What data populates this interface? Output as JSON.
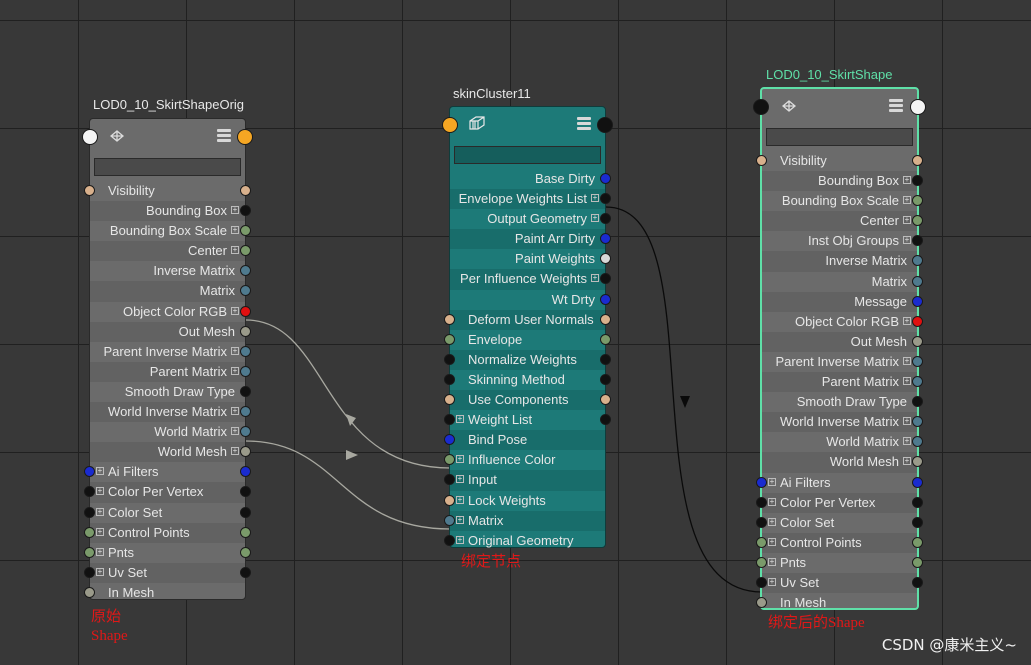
{
  "node_orig": {
    "title": "LOD0_10_SkirtShapeOrig",
    "search_value": "",
    "rows": [
      {
        "label": "Visibility",
        "side": "left",
        "exp": false,
        "lport": "#d8b08c",
        "rport": "#d8b08c"
      },
      {
        "label": "Bounding Box",
        "side": "right",
        "exp": true,
        "lport": "",
        "rport": "#111111"
      },
      {
        "label": "Bounding Box Scale",
        "side": "right",
        "exp": true,
        "lport": "",
        "rport": "#7a9a6a"
      },
      {
        "label": "Center",
        "side": "right",
        "exp": true,
        "lport": "",
        "rport": "#7a9a6a"
      },
      {
        "label": "Inverse Matrix",
        "side": "right",
        "exp": false,
        "lport": "",
        "rport": "#4f7a8e"
      },
      {
        "label": "Matrix",
        "side": "right",
        "exp": false,
        "lport": "",
        "rport": "#4f7a8e"
      },
      {
        "label": "Object Color RGB",
        "side": "right",
        "exp": true,
        "lport": "",
        "rport": "#e01010"
      },
      {
        "label": "Out Mesh",
        "side": "right",
        "exp": false,
        "lport": "",
        "rport": "#9a9a8a"
      },
      {
        "label": "Parent Inverse Matrix",
        "side": "right",
        "exp": true,
        "lport": "",
        "rport": "#4f7a8e"
      },
      {
        "label": "Parent Matrix",
        "side": "right",
        "exp": true,
        "lport": "",
        "rport": "#4f7a8e"
      },
      {
        "label": "Smooth Draw Type",
        "side": "right",
        "exp": false,
        "lport": "",
        "rport": "#111111"
      },
      {
        "label": "World Inverse Matrix",
        "side": "right",
        "exp": true,
        "lport": "",
        "rport": "#4f7a8e"
      },
      {
        "label": "World Matrix",
        "side": "right",
        "exp": true,
        "lport": "",
        "rport": "#4f7a8e"
      },
      {
        "label": "World Mesh",
        "side": "right",
        "exp": true,
        "lport": "",
        "rport": "#9a9a8a"
      },
      {
        "label": "Ai Filters",
        "side": "left",
        "exp": true,
        "lport": "#1a2bd0",
        "rport": "#1a2bd0"
      },
      {
        "label": "Color Per Vertex",
        "side": "left",
        "exp": true,
        "lport": "#111111",
        "rport": "#111111"
      },
      {
        "label": "Color Set",
        "side": "left",
        "exp": true,
        "lport": "#111111",
        "rport": "#111111"
      },
      {
        "label": "Control Points",
        "side": "left",
        "exp": true,
        "lport": "#7a9a6a",
        "rport": "#7a9a6a"
      },
      {
        "label": "Pnts",
        "side": "left",
        "exp": true,
        "lport": "#7a9a6a",
        "rport": "#7a9a6a"
      },
      {
        "label": "Uv Set",
        "side": "left",
        "exp": true,
        "lport": "#111111",
        "rport": "#111111"
      },
      {
        "label": "In Mesh",
        "side": "left",
        "exp": false,
        "lport": "#9a9a8a",
        "rport": ""
      }
    ]
  },
  "node_skin": {
    "title": "skinCluster11",
    "search_value": "",
    "rows": [
      {
        "label": "Base Dirty",
        "side": "right",
        "exp": false,
        "lport": "",
        "rport": "#1a2bd0"
      },
      {
        "label": "Envelope Weights List",
        "side": "right",
        "exp": true,
        "lport": "",
        "rport": "#111111"
      },
      {
        "label": "Output Geometry",
        "side": "right",
        "exp": true,
        "lport": "",
        "rport": "#111111"
      },
      {
        "label": "Paint Arr Dirty",
        "side": "right",
        "exp": false,
        "lport": "",
        "rport": "#1a2bd0"
      },
      {
        "label": "Paint Weights",
        "side": "right",
        "exp": false,
        "lport": "",
        "rport": "#d8d8d8"
      },
      {
        "label": "Per Influence Weights",
        "side": "right",
        "exp": true,
        "lport": "",
        "rport": "#111111"
      },
      {
        "label": "Wt Drty",
        "side": "right",
        "exp": false,
        "lport": "",
        "rport": "#1a2bd0"
      },
      {
        "label": "Deform User Normals",
        "side": "left",
        "exp": false,
        "lport": "#d8b08c",
        "rport": "#d8b08c"
      },
      {
        "label": "Envelope",
        "side": "left",
        "exp": false,
        "lport": "#7a9a6a",
        "rport": "#7a9a6a"
      },
      {
        "label": "Normalize Weights",
        "side": "left",
        "exp": false,
        "lport": "#111111",
        "rport": "#111111"
      },
      {
        "label": "Skinning Method",
        "side": "left",
        "exp": false,
        "lport": "#111111",
        "rport": "#111111"
      },
      {
        "label": "Use Components",
        "side": "left",
        "exp": false,
        "lport": "#d8b08c",
        "rport": "#d8b08c"
      },
      {
        "label": "Weight List",
        "side": "left",
        "exp": true,
        "lport": "#111111",
        "rport": "#111111"
      },
      {
        "label": "Bind Pose",
        "side": "left",
        "exp": false,
        "lport": "#1a2bd0",
        "rport": ""
      },
      {
        "label": "Influence Color",
        "side": "left",
        "exp": true,
        "lport": "#7a9a6a",
        "rport": ""
      },
      {
        "label": "Input",
        "side": "left",
        "exp": true,
        "lport": "#111111",
        "rport": ""
      },
      {
        "label": "Lock Weights",
        "side": "left",
        "exp": true,
        "lport": "#d8b08c",
        "rport": ""
      },
      {
        "label": "Matrix",
        "side": "left",
        "exp": true,
        "lport": "#4f7a8e",
        "rport": ""
      },
      {
        "label": "Original Geometry",
        "side": "left",
        "exp": true,
        "lport": "#111111",
        "rport": ""
      }
    ]
  },
  "node_shape": {
    "title": "LOD0_10_SkirtShape",
    "search_value": "",
    "rows": [
      {
        "label": "Visibility",
        "side": "left",
        "exp": false,
        "lport": "#d8b08c",
        "rport": "#d8b08c"
      },
      {
        "label": "Bounding Box",
        "side": "right",
        "exp": true,
        "lport": "",
        "rport": "#111111"
      },
      {
        "label": "Bounding Box Scale",
        "side": "right",
        "exp": true,
        "lport": "",
        "rport": "#7a9a6a"
      },
      {
        "label": "Center",
        "side": "right",
        "exp": true,
        "lport": "",
        "rport": "#7a9a6a"
      },
      {
        "label": "Inst Obj Groups",
        "side": "right",
        "exp": true,
        "lport": "",
        "rport": "#111111"
      },
      {
        "label": "Inverse Matrix",
        "side": "right",
        "exp": false,
        "lport": "",
        "rport": "#4f7a8e"
      },
      {
        "label": "Matrix",
        "side": "right",
        "exp": false,
        "lport": "",
        "rport": "#4f7a8e"
      },
      {
        "label": "Message",
        "side": "right",
        "exp": false,
        "lport": "",
        "rport": "#1a2bd0"
      },
      {
        "label": "Object Color RGB",
        "side": "right",
        "exp": true,
        "lport": "",
        "rport": "#e01010"
      },
      {
        "label": "Out Mesh",
        "side": "right",
        "exp": false,
        "lport": "",
        "rport": "#9a9a8a"
      },
      {
        "label": "Parent Inverse Matrix",
        "side": "right",
        "exp": true,
        "lport": "",
        "rport": "#4f7a8e"
      },
      {
        "label": "Parent Matrix",
        "side": "right",
        "exp": true,
        "lport": "",
        "rport": "#4f7a8e"
      },
      {
        "label": "Smooth Draw Type",
        "side": "right",
        "exp": false,
        "lport": "",
        "rport": "#111111"
      },
      {
        "label": "World Inverse Matrix",
        "side": "right",
        "exp": true,
        "lport": "",
        "rport": "#4f7a8e"
      },
      {
        "label": "World Matrix",
        "side": "right",
        "exp": true,
        "lport": "",
        "rport": "#4f7a8e"
      },
      {
        "label": "World Mesh",
        "side": "right",
        "exp": true,
        "lport": "",
        "rport": "#9a9a8a"
      },
      {
        "label": "Ai Filters",
        "side": "left",
        "exp": true,
        "lport": "#1a2bd0",
        "rport": "#1a2bd0"
      },
      {
        "label": "Color Per Vertex",
        "side": "left",
        "exp": true,
        "lport": "#111111",
        "rport": "#111111"
      },
      {
        "label": "Color Set",
        "side": "left",
        "exp": true,
        "lport": "#111111",
        "rport": "#111111"
      },
      {
        "label": "Control Points",
        "side": "left",
        "exp": true,
        "lport": "#7a9a6a",
        "rport": "#7a9a6a"
      },
      {
        "label": "Pnts",
        "side": "left",
        "exp": true,
        "lport": "#7a9a6a",
        "rport": "#7a9a6a"
      },
      {
        "label": "Uv Set",
        "side": "left",
        "exp": true,
        "lport": "#111111",
        "rport": "#111111"
      },
      {
        "label": "In Mesh",
        "side": "left",
        "exp": false,
        "lport": "#9a9a8a",
        "rport": ""
      }
    ]
  },
  "annotations": {
    "orig_line1": "原始",
    "orig_line2": "Shape",
    "skin_label": "绑定节点",
    "shape_label": "绑定后的Shape"
  },
  "watermark": "CSDN @康米主义~",
  "colors": {
    "orig_body": "#6b6b6b",
    "orig_row_alt": "#626262",
    "skin_body": "#1d7a78",
    "skin_row_alt": "#186d6b",
    "shape_body": "#6b6b6b",
    "shape_border": "#5fe0a8",
    "annotation": "#e01818",
    "wire_grey": "#a8a8a0",
    "wire_black": "#0a0a0a"
  },
  "icons": {
    "node_type_icon": "mesh-icon",
    "skin_type_icon": "skin-cluster-icon",
    "list_icon": "attribute-list-icon"
  }
}
